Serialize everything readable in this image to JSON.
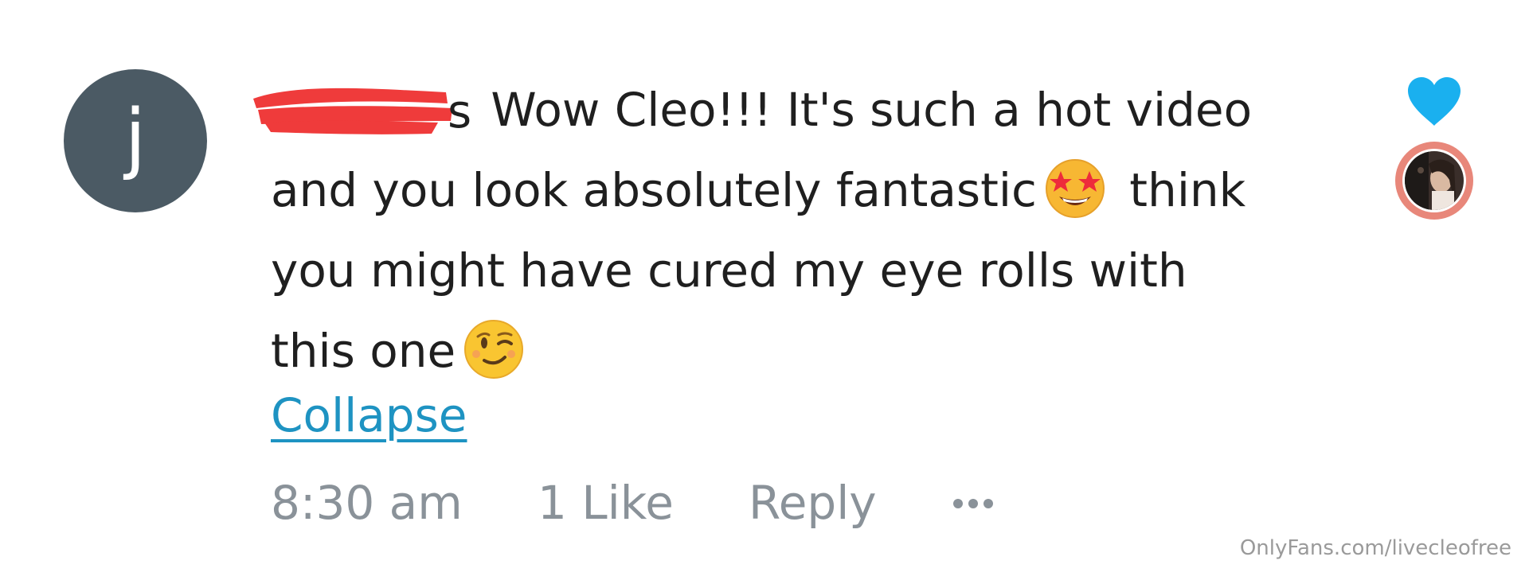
{
  "comment": {
    "author_avatar_letter": "j",
    "username_tail": "s",
    "lines": [
      " Wow Cleo!!! It's such a hot video",
      "and you look absolutely fantastic",
      " think",
      "you might have cured my eye rolls with",
      "this one"
    ],
    "collapse_label": "Collapse"
  },
  "meta": {
    "time": "8:30 am",
    "likes": "1 Like",
    "reply": "Reply"
  },
  "icons": {
    "heart": "heart-icon",
    "more": "more-dots-icon",
    "emoji_1": "star-struck-emoji",
    "emoji_2": "winking-face-emoji"
  },
  "colors": {
    "avatar_bg": "#4b5a64",
    "heart": "#1ab0ef",
    "link": "#1e93c2",
    "meta_text": "#8a9299",
    "redaction": "#ef3b3b",
    "creator_ring": "#e8877a"
  },
  "watermark": "OnlyFans.com/livecleofree"
}
